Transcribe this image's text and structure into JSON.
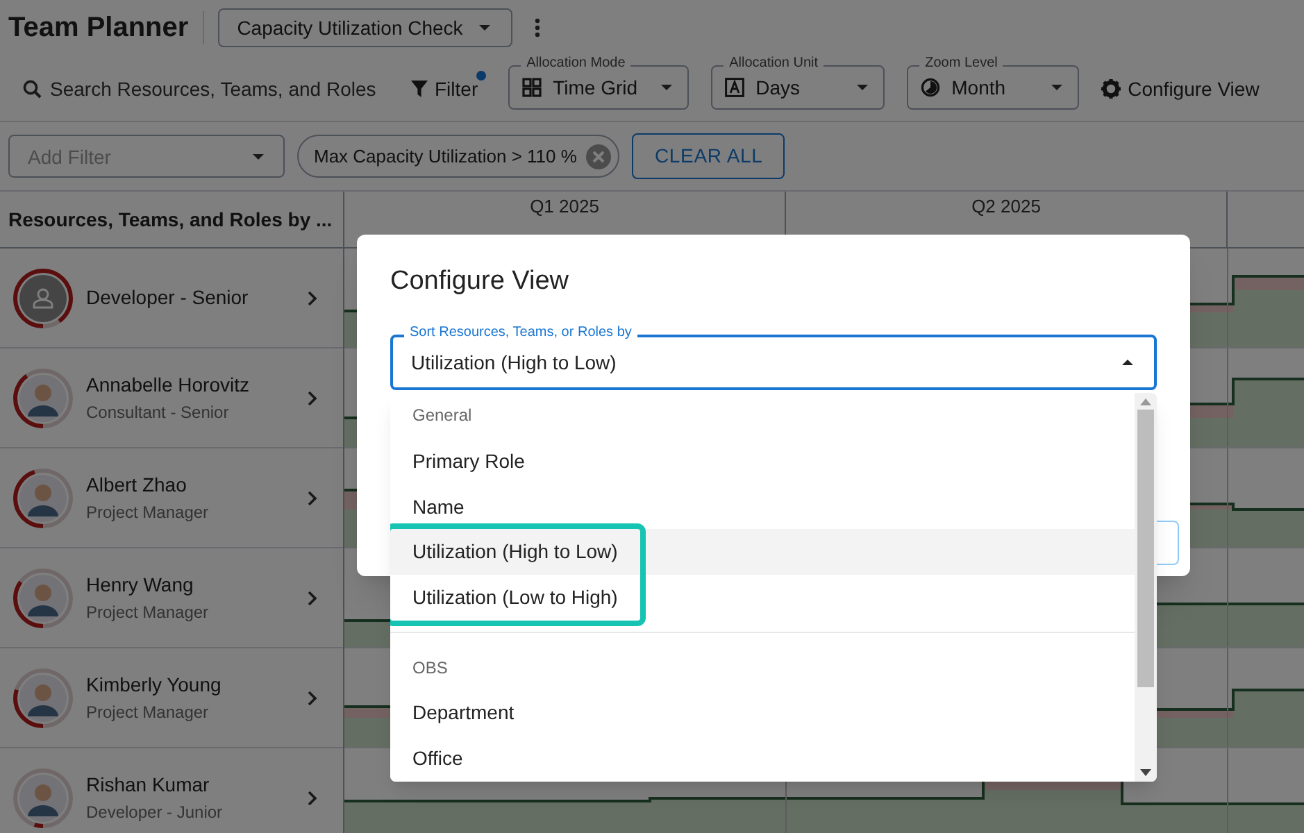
{
  "header": {
    "title": "Team Planner",
    "view_select": {
      "value": "Capacity Utilization Check"
    }
  },
  "toolbar": {
    "search": {
      "placeholder": "Search Resources, Teams, and Roles"
    },
    "filter": {
      "label": "Filter",
      "active": true
    },
    "selects": [
      {
        "label": "Allocation Mode",
        "value": "Time Grid",
        "kind": "grid"
      },
      {
        "label": "Allocation Unit",
        "value": "Days",
        "kind": "letter"
      },
      {
        "label": "Zoom Level",
        "value": "Month",
        "kind": "clock"
      }
    ],
    "configure": {
      "label": "Configure View"
    }
  },
  "filters": {
    "add_filter": {
      "placeholder": "Add Filter"
    },
    "chips": [
      {
        "label": "Max Capacity Utilization > 110 %"
      }
    ],
    "clear_all": "CLEAR ALL"
  },
  "resources": {
    "heading": "Resources, Teams, and Roles by ...",
    "rows": [
      {
        "name": "Developer - Senior",
        "kind": "role",
        "level": 0.9
      },
      {
        "name": "Annabelle Horovitz",
        "role": "Consultant - Senior",
        "kind": "person",
        "level": 0.4
      },
      {
        "name": "Albert Zhao",
        "role": "Project Manager",
        "kind": "person",
        "level": 0.45
      },
      {
        "name": "Henry Wang",
        "role": "Project Manager",
        "kind": "person",
        "level": 0.35
      },
      {
        "name": "Kimberly Young",
        "role": "Project Manager",
        "kind": "person",
        "level": 0.3
      },
      {
        "name": "Rishan Kumar",
        "role": "Developer - Junior",
        "kind": "person",
        "level": 0.05
      }
    ]
  },
  "timeline": {
    "quarters": [
      "Q1 2025",
      "Q2 2025"
    ]
  },
  "dialog": {
    "title": "Configure View",
    "sort_select": {
      "label": "Sort Resources, Teams, or Roles by",
      "value": "Utilization (High to Low)",
      "expanded": true
    },
    "menu": {
      "groups": [
        {
          "heading": "General",
          "options": [
            {
              "label": "Primary Role",
              "selected": false,
              "highlighted": false
            },
            {
              "label": "Name",
              "selected": false,
              "highlighted": false
            },
            {
              "label": "Utilization (High to Low)",
              "selected": true,
              "highlighted": true
            },
            {
              "label": "Utilization (Low to High)",
              "selected": false,
              "highlighted": true
            }
          ]
        },
        {
          "heading": "OBS",
          "options": [
            {
              "label": "Department",
              "selected": false,
              "highlighted": false
            },
            {
              "label": "Office",
              "selected": false,
              "highlighted": false
            }
          ]
        }
      ]
    }
  }
}
